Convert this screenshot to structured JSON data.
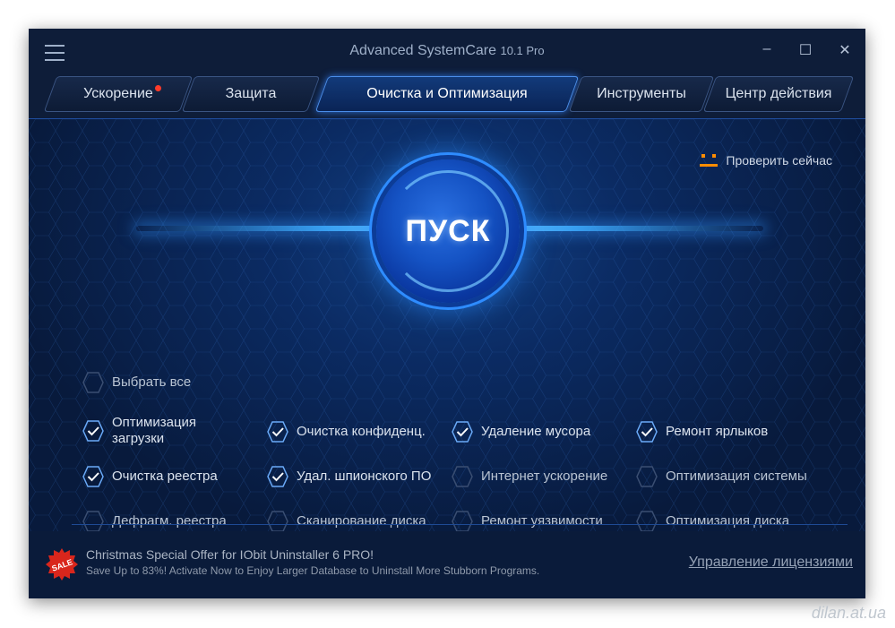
{
  "window": {
    "app_name": "Advanced SystemCare",
    "version": "10.1 Pro",
    "controls": {
      "minimize": "‒",
      "maximize": "☐",
      "close": "✕"
    }
  },
  "tabs": [
    {
      "label": "Ускорение",
      "badge": "red-dot"
    },
    {
      "label": "Защита"
    },
    {
      "label": "Очистка и Оптимизация",
      "active": true
    },
    {
      "label": "Инструменты"
    },
    {
      "label": "Центр действия"
    }
  ],
  "main": {
    "check_now": "Проверить сейчас",
    "start_button": "ПУСК",
    "select_all": "Выбрать все",
    "options": [
      {
        "label": "Оптимизация\nзагрузки",
        "checked": true
      },
      {
        "label": "Очистка конфиденц.",
        "checked": true
      },
      {
        "label": "Удаление мусора",
        "checked": true
      },
      {
        "label": "Ремонт ярлыков",
        "checked": true
      },
      {
        "label": "Очистка реестра",
        "checked": true
      },
      {
        "label": "Удал. шпионского ПО",
        "checked": true
      },
      {
        "label": "Интернет ускорение",
        "checked": false
      },
      {
        "label": "Оптимизация системы",
        "checked": false
      },
      {
        "label": "Дефрагм. реестра",
        "checked": false
      },
      {
        "label": "Сканирование диска",
        "checked": false
      },
      {
        "label": "Ремонт уязвимости",
        "checked": false
      },
      {
        "label": "Оптимизация диска",
        "checked": false
      }
    ]
  },
  "footer": {
    "sale_badge": "SALE",
    "offer_title": "Christmas Special Offer for IObit Uninstaller 6 PRO!",
    "offer_subtitle": "Save Up to 83%! Activate Now to Enjoy Larger Database to Uninstall More Stubborn Programs.",
    "license_link": "Управление лицензиями"
  },
  "watermark": "dilan.at.ua",
  "colors": {
    "window_bg": "#081a3c",
    "accent_blue": "#2e8cff",
    "check_orange": "#ff8c00",
    "badge_red": "#ff3b2a"
  },
  "icons": [
    "hamburger-menu-icon",
    "face-icon",
    "checkbox-hex-icon",
    "sale-badge-icon"
  ]
}
